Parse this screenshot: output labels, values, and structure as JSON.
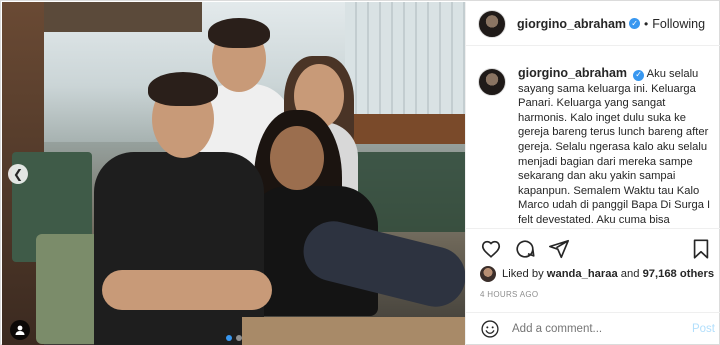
{
  "post": {
    "username": "giorgino_abraham",
    "separator": "•",
    "follow_state": "Following",
    "caption_username": "giorgino_abraham",
    "caption_text": "Aku selalu sayang sama keluarga ini. Keluarga Panari. Keluarga yang sangat harmonis. Kalo inget dulu suka ke gereja bareng terus lunch bareng after gereja. Selalu ngerasa kalo aku selalu menjadi bagian dari mereka sampe sekarang dan aku yakin sampai kapanpun. Semalem Waktu tau Kalo Marco udah di panggil Bapa Di Surga I felt devestated. Aku cuma bisa",
    "likes_prefix": "Liked by",
    "likes_user": "wanda_haraa",
    "likes_and": "and",
    "likes_count": "97,168 others",
    "timestamp": "4 HOURS AGO"
  },
  "comment": {
    "placeholder": "Add a comment...",
    "post_label": "Post"
  },
  "carousel": {
    "total": 2,
    "active_index": 1
  },
  "icons": {
    "like": "heart-icon",
    "comment": "comment-icon",
    "share": "share-icon",
    "save": "bookmark-icon",
    "emoji": "emoji-icon",
    "tag": "user-tag-icon",
    "prev": "chevron-left-icon"
  },
  "colors": {
    "verified": "#3897f0",
    "active_dot": "#3897f0",
    "post_button": "#b2dffc",
    "muted": "#8e8e8e"
  }
}
